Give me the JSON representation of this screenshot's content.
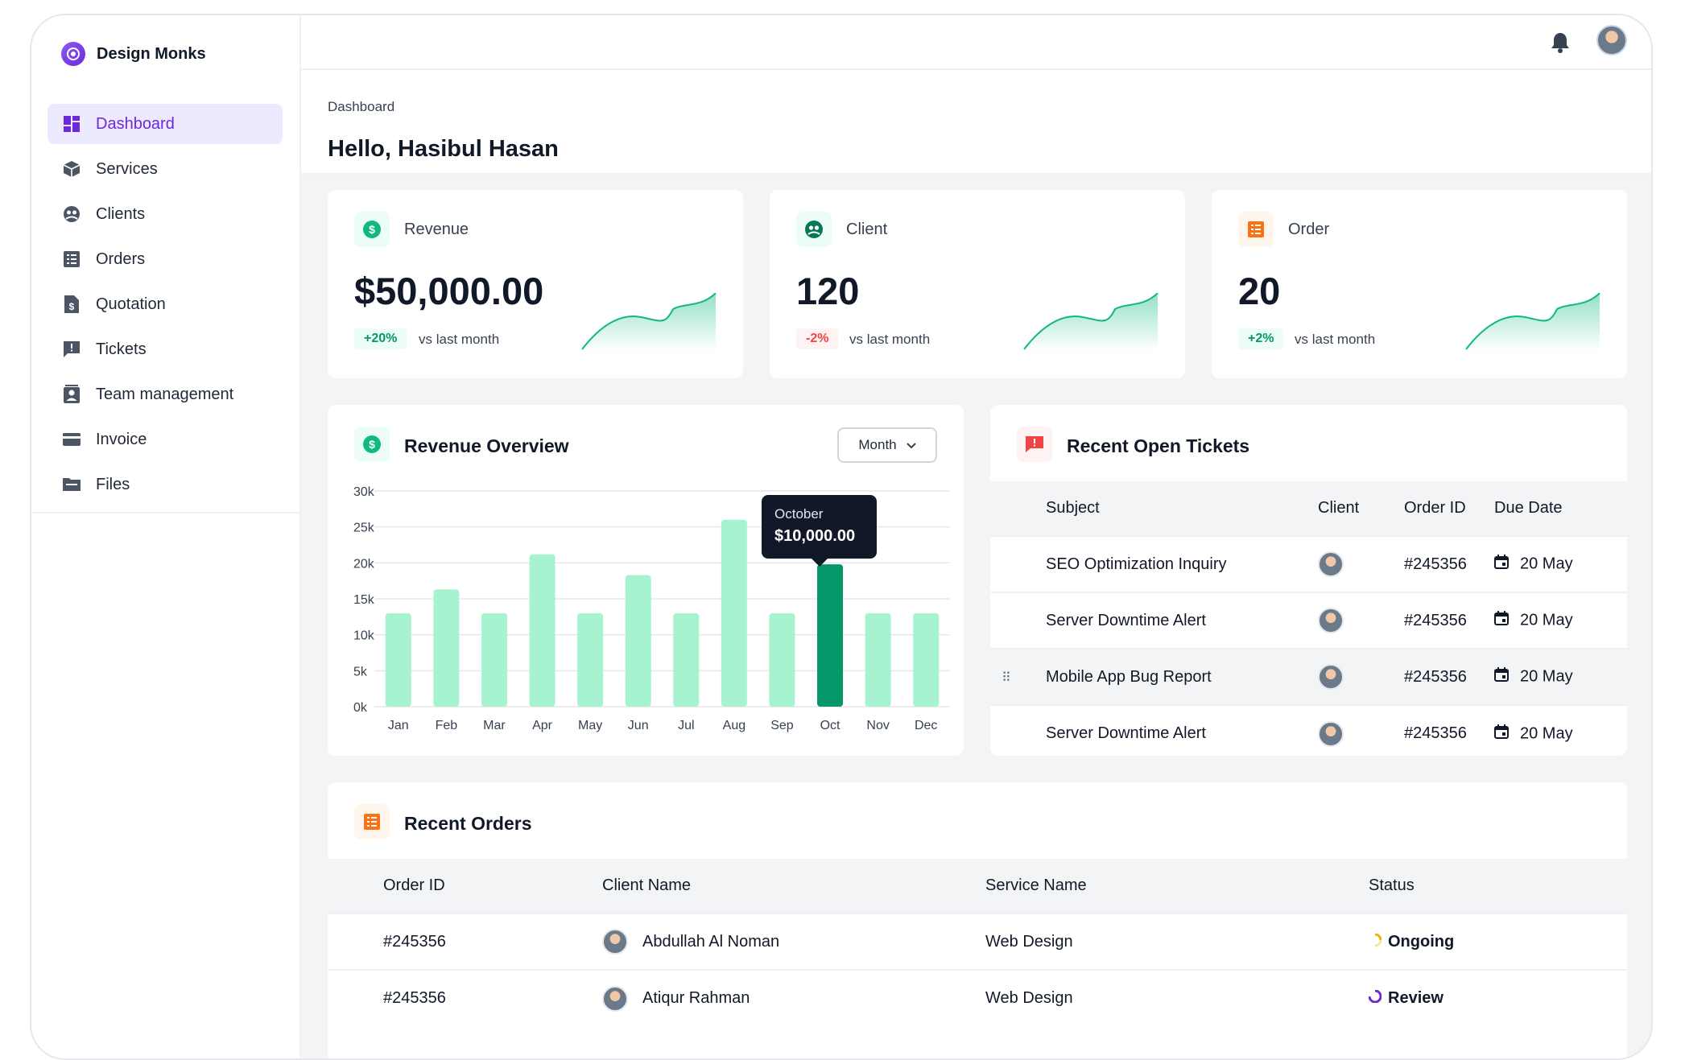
{
  "brand": {
    "name": "Design Monks"
  },
  "sidebar": {
    "items": [
      {
        "label": "Dashboard",
        "icon": "dashboard-icon",
        "active": true
      },
      {
        "label": "Services",
        "icon": "cube-icon"
      },
      {
        "label": "Clients",
        "icon": "clients-icon"
      },
      {
        "label": "Orders",
        "icon": "list-icon"
      },
      {
        "label": "Quotation",
        "icon": "document-dollar-icon"
      },
      {
        "label": "Tickets",
        "icon": "ticket-chat-icon"
      },
      {
        "label": "Team management",
        "icon": "contact-card-icon"
      },
      {
        "label": "Invoice",
        "icon": "credit-card-icon"
      },
      {
        "label": "Files",
        "icon": "folder-icon"
      }
    ]
  },
  "header": {
    "breadcrumb": "Dashboard",
    "greeting": "Hello, Hasibul Hasan"
  },
  "stats": [
    {
      "label": "Revenue",
      "value": "$50,000.00",
      "change": "+20%",
      "direction": "up",
      "compare": "vs last month",
      "icon": "dollar-icon",
      "color": "#10b981"
    },
    {
      "label": "Client",
      "value": "120",
      "change": "-2%",
      "direction": "down",
      "compare": "vs last month",
      "icon": "clients-icon",
      "color": "#047857"
    },
    {
      "label": "Order",
      "value": "20",
      "change": "+2%",
      "direction": "up",
      "compare": "vs last month",
      "icon": "list-icon",
      "color": "#f97316"
    }
  ],
  "revenue_overview": {
    "title": "Revenue Overview",
    "period": "Month",
    "tooltip": {
      "label": "October",
      "value": "$10,000.00"
    }
  },
  "chart_data": {
    "type": "bar",
    "categories": [
      "Jan",
      "Feb",
      "Mar",
      "Apr",
      "May",
      "Jun",
      "Jul",
      "Aug",
      "Sep",
      "Oct",
      "Nov",
      "Dec"
    ],
    "values": [
      13000,
      16300,
      13000,
      21200,
      13000,
      18300,
      13000,
      26000,
      13000,
      19800,
      13000,
      13000
    ],
    "highlight": "Oct",
    "yticks": [
      "0k",
      "5k",
      "10k",
      "15k",
      "20k",
      "25k",
      "30k"
    ],
    "ylim": [
      0,
      30000
    ],
    "grid": true,
    "colors": {
      "bar": "#a7f3d0",
      "highlight": "#059669"
    }
  },
  "tickets": {
    "title": "Recent Open Tickets",
    "columns": [
      "Subject",
      "Client",
      "Order ID",
      "Due Date"
    ],
    "rows": [
      {
        "subject": "SEO Optimization Inquiry",
        "order_id": "#245356",
        "due": "20 May"
      },
      {
        "subject": "Server Downtime Alert",
        "order_id": "#245356",
        "due": "20 May"
      },
      {
        "subject": "Mobile App Bug Report",
        "order_id": "#245356",
        "due": "20 May"
      },
      {
        "subject": "Server Downtime Alert",
        "order_id": "#245356",
        "due": "20 May"
      }
    ]
  },
  "orders": {
    "title": "Recent Orders",
    "columns": [
      "Order ID",
      "Client Name",
      "Service Name",
      "Status"
    ],
    "rows": [
      {
        "order_id": "#245356",
        "client": "Abdullah Al Noman",
        "service": "Web Design",
        "status": "Ongoing"
      },
      {
        "order_id": "#245356",
        "client": "Atiqur Rahman",
        "service": "Web Design",
        "status": "Review"
      }
    ]
  }
}
